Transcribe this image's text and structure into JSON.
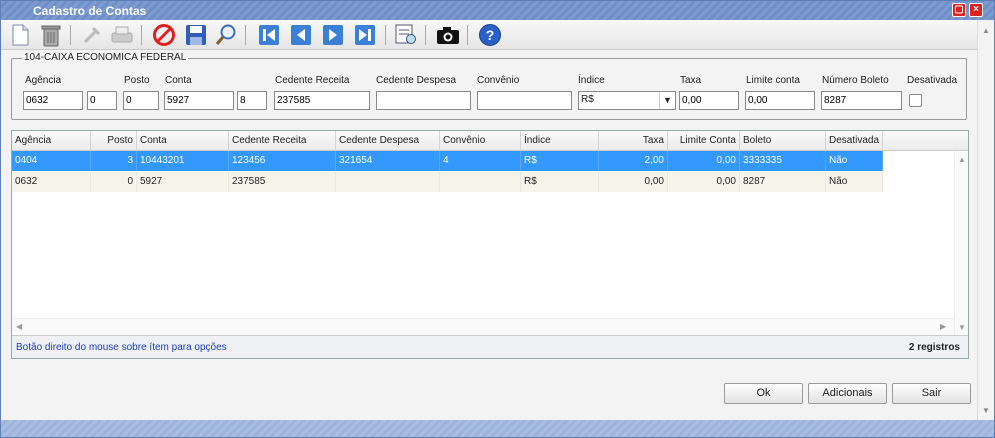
{
  "window": {
    "title": "Cadastro de Contas"
  },
  "toolbar": {
    "icons": [
      "new-document-icon",
      "trash-icon",
      "tools-icon",
      "printer-icon",
      "cancel-icon",
      "save-icon",
      "search-icon",
      "first-record-icon",
      "previous-record-icon",
      "next-record-icon",
      "last-record-icon",
      "report-icon",
      "camera-icon",
      "help-icon"
    ]
  },
  "form": {
    "group_label": "104-CAIXA ECONOMICA FEDERAL",
    "labels": {
      "agencia": "Agência",
      "posto": "Posto",
      "conta": "Conta",
      "cedente_receita": "Cedente Receita",
      "cedente_despesa": "Cedente Despesa",
      "convenio": "Convênio",
      "indice": "Índice",
      "taxa": "Taxa",
      "limite_conta": "Limite conta",
      "numero_boleto": "Número Boleto",
      "desativada": "Desativada"
    },
    "values": {
      "agencia": "0632",
      "agencia_dv": "0",
      "posto": "0",
      "conta": "5927",
      "conta_dv": "8",
      "cedente_receita": "237585",
      "cedente_despesa": "",
      "convenio": "",
      "indice": "R$",
      "taxa": "0,00",
      "limite_conta": "0,00",
      "numero_boleto": "8287"
    },
    "desativada_checked": false
  },
  "grid": {
    "columns": [
      "Agência",
      "Posto",
      "Conta",
      "Cedente Receita",
      "Cedente Despesa",
      "Convênio",
      "Índice",
      "Taxa",
      "Limite Conta",
      "Boleto",
      "Desativada"
    ],
    "rows": [
      [
        "0404",
        "3",
        "10443201",
        "123456",
        "321654",
        "4",
        "R$",
        "2,00",
        "0,00",
        "3333335",
        "Não"
      ],
      [
        "0632",
        "0",
        "5927",
        "237585",
        "",
        "",
        "R$",
        "0,00",
        "0,00",
        "8287",
        "Não"
      ]
    ],
    "selected_row": 0,
    "hint": "Botão direito do mouse sobre ítem para opções",
    "count": "2 registros"
  },
  "buttons": {
    "ok": "Ok",
    "adicionais": "Adicionais",
    "sair": "Sair"
  },
  "colors": {
    "title_bar": "#6f8fc8",
    "selected_row": "#3399ff",
    "hint_text": "#1a3fb8"
  }
}
